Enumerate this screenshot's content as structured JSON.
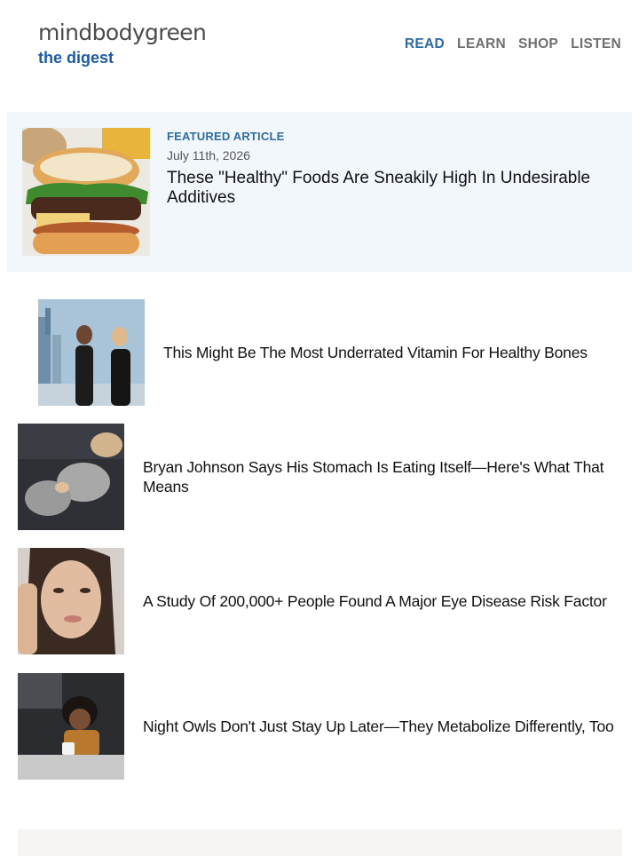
{
  "brand": {
    "name": "mindbodygreen",
    "sub": "the digest"
  },
  "nav": [
    {
      "label": "READ",
      "active": true
    },
    {
      "label": "LEARN",
      "active": false
    },
    {
      "label": "SHOP",
      "active": false
    },
    {
      "label": "LISTEN",
      "active": false
    }
  ],
  "featured": {
    "eyebrow": "FEATURED ARTICLE",
    "date": "July 11th, 2026",
    "title": "These \"Healthy\" Foods Are Sneakily High In Undesirable Additives",
    "image": "burger-photo"
  },
  "articles": [
    {
      "title": "This Might Be The Most Underrated Vitamin For Healthy Bones",
      "image": "women-city-rooftop-photo"
    },
    {
      "title": "Bryan Johnson Says His Stomach Is Eating Itself—Here's What That Means",
      "image": "woman-lying-in-bed-photo"
    },
    {
      "title": "A Study Of 200,000+ People Found A Major Eye Disease Risk Factor",
      "image": "woman-touching-eye-photo"
    },
    {
      "title": "Night Owls Don't Just Stay Up Later—They Metabolize Differently, Too",
      "image": "woman-night-mug-photo"
    }
  ],
  "colors": {
    "accent": "#2e6aa6",
    "featured_bg": "#f1f7fb",
    "footer_bg": "#f6f5f1"
  }
}
